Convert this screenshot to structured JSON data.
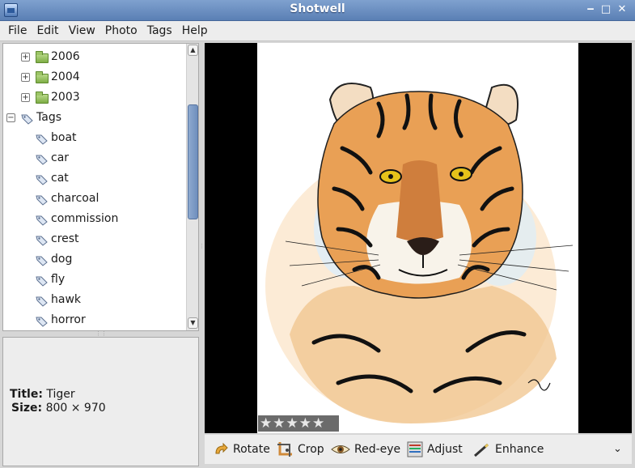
{
  "window": {
    "title": "Shotwell"
  },
  "menu": [
    "File",
    "Edit",
    "View",
    "Photo",
    "Tags",
    "Help"
  ],
  "tree": {
    "years": [
      "2006",
      "2004",
      "2003"
    ],
    "tags_header": "Tags",
    "tags": [
      "boat",
      "car",
      "cat",
      "charcoal",
      "commission",
      "crest",
      "dog",
      "fly",
      "hawk",
      "horror"
    ]
  },
  "info": {
    "title_key": "Title:",
    "title_value": "Tiger",
    "size_key": "Size:",
    "size_value": "800 × 970"
  },
  "photo": {
    "rating_stars": 5,
    "rating_glyphs": "★★★★★"
  },
  "toolbar": {
    "rotate": "Rotate",
    "crop": "Crop",
    "redeye": "Red-eye",
    "adjust": "Adjust",
    "enhance": "Enhance"
  },
  "colors": {
    "titlebar": "#6a8dc2",
    "scroll_thumb": "#7f9cc6",
    "viewer_bg": "#000000"
  },
  "icons": [
    "app-icon",
    "minimize-icon",
    "maximize-icon",
    "close-icon",
    "expand-icon",
    "collapse-icon",
    "folder-icon",
    "tag-icon",
    "rotate-icon",
    "crop-icon",
    "red-eye-icon",
    "adjust-icon",
    "enhance-icon",
    "chevron-down-icon"
  ]
}
